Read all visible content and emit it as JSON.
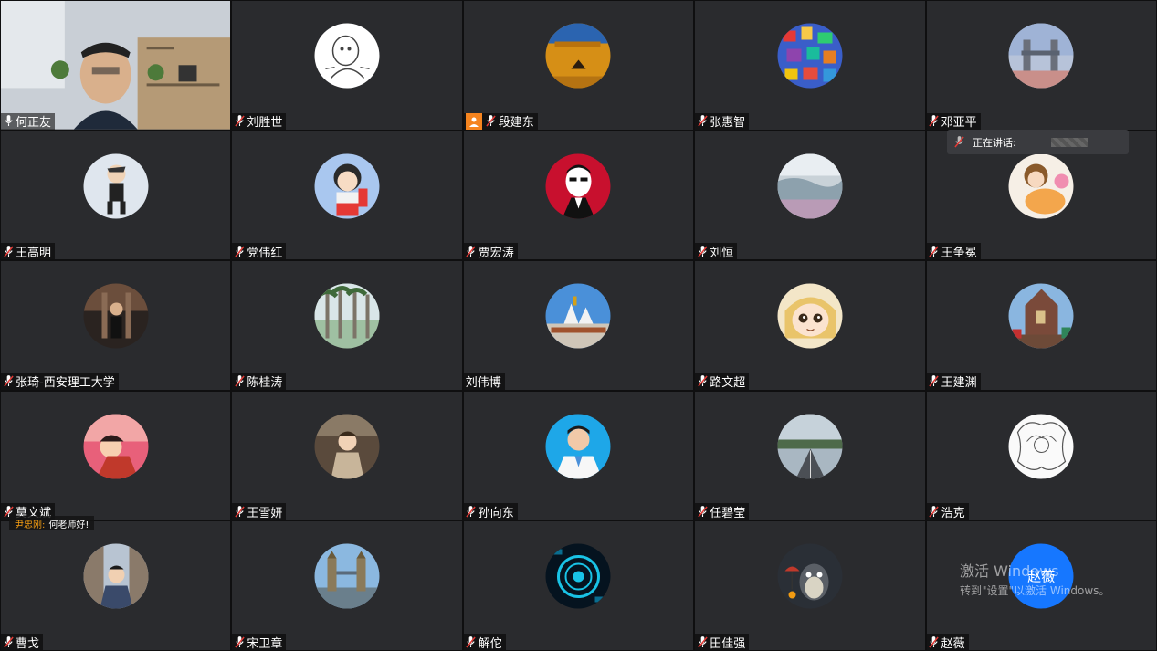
{
  "participants": [
    {
      "name": "何正友",
      "mic": "on"
    },
    {
      "name": "刘胜世",
      "mic": "muted"
    },
    {
      "name": "段建东",
      "mic": "muted",
      "host": true
    },
    {
      "name": "张惠智",
      "mic": "muted"
    },
    {
      "name": "邓亚平",
      "mic": "muted"
    },
    {
      "name": "王高明",
      "mic": "muted"
    },
    {
      "name": "党伟红",
      "mic": "muted"
    },
    {
      "name": "贾宏涛",
      "mic": "muted"
    },
    {
      "name": "刘恒",
      "mic": "muted"
    },
    {
      "name": "王争冕",
      "mic": "muted"
    },
    {
      "name": "张琦-西安理工大学",
      "mic": "muted"
    },
    {
      "name": "陈桂涛",
      "mic": "muted"
    },
    {
      "name": "刘伟博",
      "mic": "none"
    },
    {
      "name": "路文超",
      "mic": "muted"
    },
    {
      "name": "王建渊",
      "mic": "muted"
    },
    {
      "name": "莫文斌",
      "mic": "muted"
    },
    {
      "name": "王雪妍",
      "mic": "muted"
    },
    {
      "name": "孙向东",
      "mic": "muted"
    },
    {
      "name": "任碧莹",
      "mic": "muted"
    },
    {
      "name": "浩克",
      "mic": "muted"
    },
    {
      "name": "曹戈",
      "mic": "muted"
    },
    {
      "name": "宋卫章",
      "mic": "muted"
    },
    {
      "name": "解佗",
      "mic": "muted"
    },
    {
      "name": "田佳强",
      "mic": "muted"
    },
    {
      "name": "赵薇",
      "mic": "muted",
      "initials": "赵薇"
    }
  ],
  "speaking": {
    "label": "正在讲话:"
  },
  "chat": {
    "from": "尹忠刚:",
    "message": "何老师好!"
  },
  "watermark": {
    "line1": "激活 Windows",
    "line2": "转到\"设置\"以激活 Windows。"
  },
  "colors": {
    "tile": "#2a2b2e",
    "mute": "#e53935",
    "host": "#f5841f",
    "accent": "#1677ff"
  }
}
